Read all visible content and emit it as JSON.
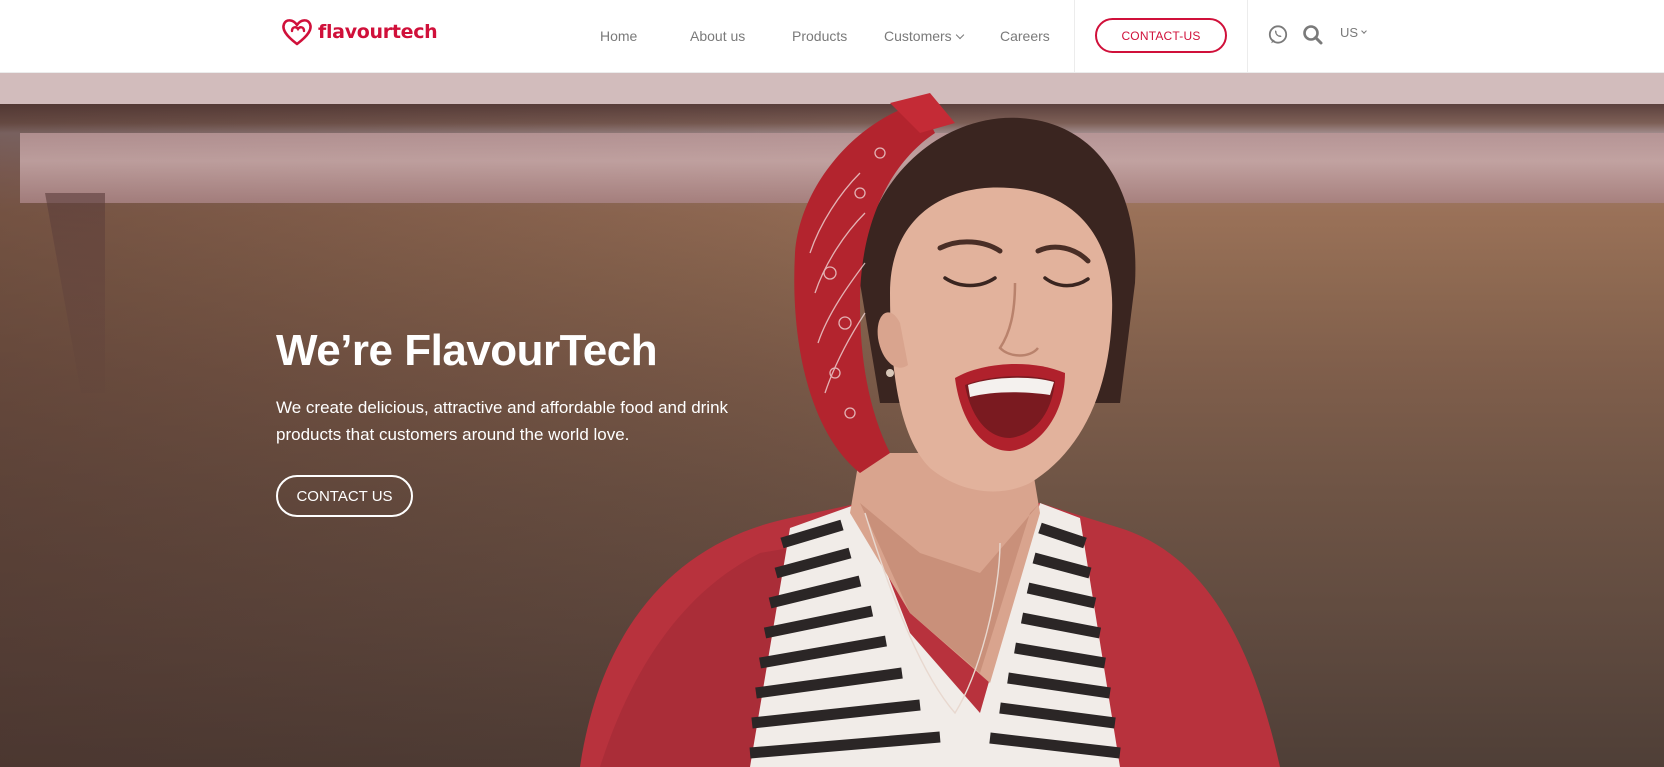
{
  "brand": {
    "name": "flavourtech",
    "logo_icon": "double-heart-logo",
    "color": "#d0103a"
  },
  "nav": {
    "items": [
      {
        "label": "Home"
      },
      {
        "label": "About us"
      },
      {
        "label": "Products"
      },
      {
        "label": "Customers",
        "has_dropdown": true
      },
      {
        "label": "Careers"
      }
    ],
    "contact_button": "CONTACT-US",
    "whatsapp_icon": "whatsapp-icon",
    "search_icon": "search-icon",
    "language": "US"
  },
  "hero": {
    "title": "We’re FlavourTech",
    "subtitle": "We create delicious, attractive and affordable food and drink products that customers around the world love.",
    "button": "CONTACT US"
  }
}
